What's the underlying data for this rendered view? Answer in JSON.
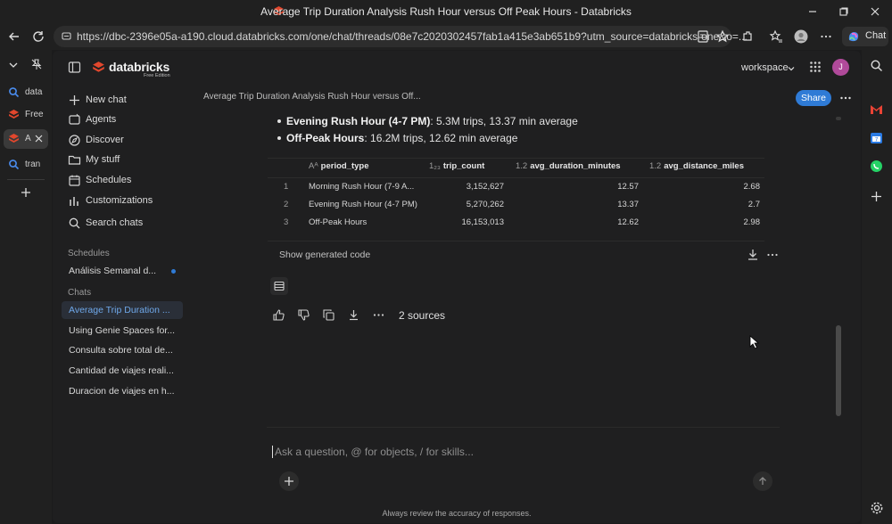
{
  "browser": {
    "window_title": "Average Trip Duration Analysis Rush Hour versus Off Peak Hours - Databricks",
    "url": "https://dbc-2396e05a-a190.cloud.databricks.com/one/chat/threads/08e7c2020302457fab1a415e3ab651b9?utm_source=databricks-one&o=...",
    "chat_button": "Chat",
    "tabs": [
      {
        "label": "data",
        "icon": "search-icon"
      },
      {
        "label": "Free",
        "icon": "databricks-icon"
      },
      {
        "label": "A",
        "icon": "databricks-icon"
      },
      {
        "label": "tran",
        "icon": "search-icon"
      }
    ]
  },
  "app": {
    "logo_text": "databricks",
    "logo_sub": "Free Edition",
    "workspace_label": "workspace",
    "avatar_initial": "J",
    "share_label": "Share",
    "breadcrumb": "Average Trip Duration Analysis Rush Hour versus Off..."
  },
  "sidebar": {
    "nav": [
      {
        "label": "New chat",
        "icon": "plus-icon"
      },
      {
        "label": "Agents",
        "icon": "agents-icon"
      },
      {
        "label": "Discover",
        "icon": "compass-icon"
      },
      {
        "label": "My stuff",
        "icon": "folder-icon"
      },
      {
        "label": "Schedules",
        "icon": "calendar-icon"
      },
      {
        "label": "Customizations",
        "icon": "chart-icon"
      },
      {
        "label": "Search chats",
        "icon": "search-icon"
      }
    ],
    "schedules_label": "Schedules",
    "schedules": [
      "Análisis Semanal d..."
    ],
    "chats_label": "Chats",
    "chats": [
      "Average Trip Duration ...",
      "Using Genie Spaces for...",
      "Consulta sobre total de...",
      "Cantidad de viajes reali...",
      "Duracion de viajes en h..."
    ]
  },
  "content": {
    "bullets": [
      {
        "bold": "Evening Rush Hour (4-7 PM)",
        "rest": ": 5.3M trips, 13.37 min average"
      },
      {
        "bold": "Off-Peak Hours",
        "rest": ": 16.2M trips, 12.62 min average"
      }
    ],
    "table": {
      "columns": [
        {
          "type": "Aᴬ",
          "name": "period_type"
        },
        {
          "type": "1₂₃",
          "name": "trip_count"
        },
        {
          "type": "1.2",
          "name": "avg_duration_minutes"
        },
        {
          "type": "1.2",
          "name": "avg_distance_miles"
        }
      ],
      "rows": [
        {
          "idx": "1",
          "period_type": "Morning Rush Hour (7-9 A...",
          "trip_count": "3,152,627",
          "avg_duration_minutes": "12.57",
          "avg_distance_miles": "2.68"
        },
        {
          "idx": "2",
          "period_type": "Evening Rush Hour (4-7 PM)",
          "trip_count": "5,270,262",
          "avg_duration_minutes": "13.37",
          "avg_distance_miles": "2.7"
        },
        {
          "idx": "3",
          "period_type": "Off-Peak Hours",
          "trip_count": "16,153,013",
          "avg_duration_minutes": "12.62",
          "avg_distance_miles": "2.98"
        }
      ]
    },
    "show_code_label": "Show generated code",
    "sources_label": "2 sources",
    "composer_placeholder": "Ask a question, @ for objects, / for skills...",
    "footer": "Always review the accuracy of responses."
  },
  "colors": {
    "accent": "#2f7bd6",
    "selected_chat_bg": "#2a2f38",
    "selected_chat_text": "#6fa8ea",
    "databricks_red": "#e2472d"
  }
}
